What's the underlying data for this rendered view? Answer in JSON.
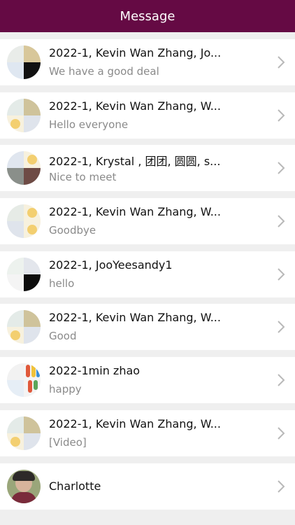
{
  "header": {
    "title": "Message"
  },
  "conversations": [
    {
      "title": "2022-1, Kevin Wan Zhang, Jo...",
      "preview": "We have a good deal"
    },
    {
      "title": "2022-1, Kevin Wan Zhang, W...",
      "preview": "Hello everyone"
    },
    {
      "title": "2022-1, Krystal , 团团, 圆圆, s...",
      "preview": "Nice to meet"
    },
    {
      "title": "2022-1, Kevin Wan Zhang, W...",
      "preview": "Goodbye"
    },
    {
      "title": "2022-1, JooYeesandy1",
      "preview": "hello"
    },
    {
      "title": "2022-1, Kevin Wan Zhang, W...",
      "preview": "Good"
    },
    {
      "title": "2022-1min zhao",
      "preview": "happy"
    },
    {
      "title": "2022-1, Kevin Wan Zhang, W...",
      "preview": "[Video]"
    },
    {
      "title": "Charlotte",
      "preview": ""
    }
  ],
  "colors": {
    "header_bg": "#650a44",
    "title_text": "#111111",
    "preview_text": "#8a8a8a"
  },
  "icons": {
    "row_action": "chevron-right-icon"
  }
}
